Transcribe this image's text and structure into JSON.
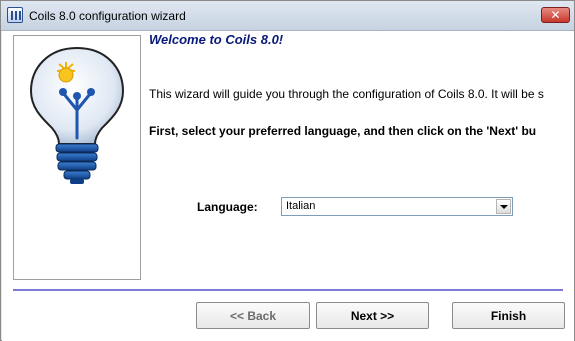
{
  "window": {
    "title": "Coils 8.0 configuration wizard",
    "close_label": "✕"
  },
  "main": {
    "welcome_title": "Welcome to Coils 8.0!",
    "intro_text": "This wizard will guide you through the configuration of Coils 8.0. It will be s",
    "instruction_text": "First, select your preferred language, and then click on the 'Next' bu"
  },
  "language": {
    "label": "Language:",
    "selected": "Italian"
  },
  "buttons": {
    "back": "<< Back",
    "next": "Next >>",
    "finish": "Finish"
  },
  "colors": {
    "title_accent": "#0a1a78",
    "divider": "#7b7bd6",
    "close_button": "#c7382c"
  },
  "icons": {
    "app": "coils-app-icon",
    "close": "close-icon",
    "logo": "lightbulb-icon",
    "dropdown": "chevron-down-icon"
  }
}
